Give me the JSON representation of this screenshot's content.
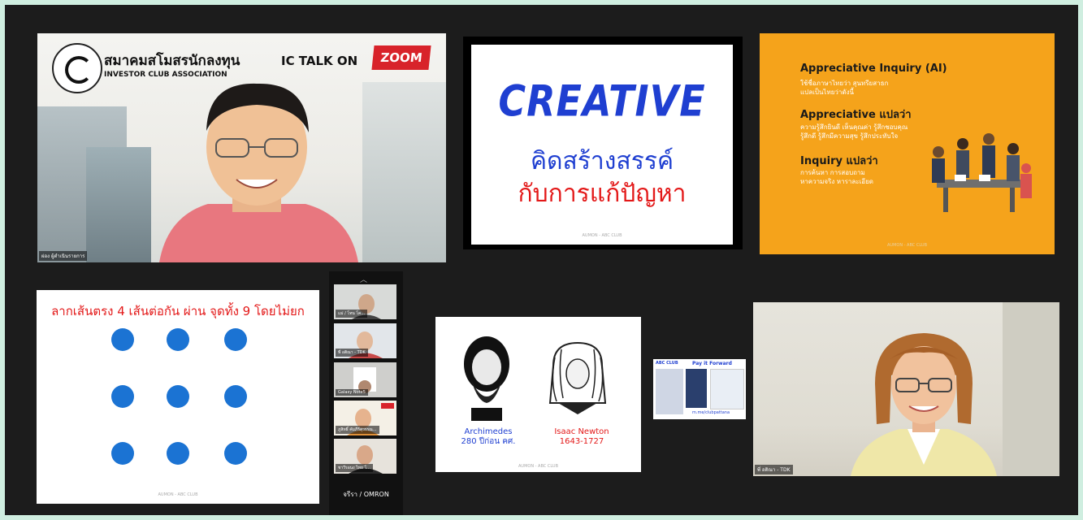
{
  "tile_speaker": {
    "assoc_name_th": "สมาคมสโมสรนักลงทุน",
    "assoc_name_en": "INVESTOR CLUB ASSOCIATION",
    "ic_talk": "IC TALK ON",
    "zoom_badge": "ZOOM",
    "name_tag": "ผ่อง ผู้ดำเนินรายการ"
  },
  "tile_creative": {
    "heading": "CREATIVE",
    "line1": "คิดสร้างสรรค์",
    "line2": "กับการแก้ปัญหา",
    "footer": "AUMON - ABC CLUB"
  },
  "tile_ai": {
    "h1": "Appreciative Inquiry (AI)",
    "s1": [
      "ใช้ชื่อภาษาไทยว่า สุนทรียสาธก",
      "แปลเป็นไทยว่าดังนี้"
    ],
    "h2": "Appreciative แปลว่า",
    "s2": [
      "ความรู้สึกยินดี เห็นคุณค่า รู้สึกชอบคุณ",
      "รู้สึกดี รู้สึกมีความสุข รู้สึกประทับใจ"
    ],
    "h3": "Inquiry แปลว่า",
    "s3": [
      "การค้นหา การสอบถาม",
      "หาความจริง หาราละเอียด"
    ],
    "footer": "AUMON - ABC CLUB"
  },
  "tile_dots": {
    "title": "ลากเส้นตรง 4 เส้นต่อกัน ผ่าน จุดทั้ง 9 โดยไม่ยก",
    "footer": "AUMON - ABC CLUB"
  },
  "strip": {
    "thumbs": [
      {
        "name": "แม่ / โทน โค..."
      },
      {
        "name": "พี่ อติณา - TDK"
      },
      {
        "name": "Galaxy Note5"
      },
      {
        "name": "ภูสิทธิ์ คัมภีร์สุวรรณ..."
      },
      {
        "name": "ชาวีรอนง ไทย โ..."
      }
    ],
    "active_name": "จรีรา / OMRON"
  },
  "tile_scientists": {
    "left_name": "Archimedes",
    "left_dates": "280 ปีก่อน คศ.",
    "right_name": "Isaac Newton",
    "right_dates": "1643-1727",
    "footer": "AUMON - ABC CLUB"
  },
  "tile_payforward": {
    "brand": "ABC CLUB",
    "title": "Pay it Forward",
    "link": "m.me/clubpattana"
  },
  "tile_woman": {
    "name_tag": "พี่ อติณา - TDK"
  }
}
